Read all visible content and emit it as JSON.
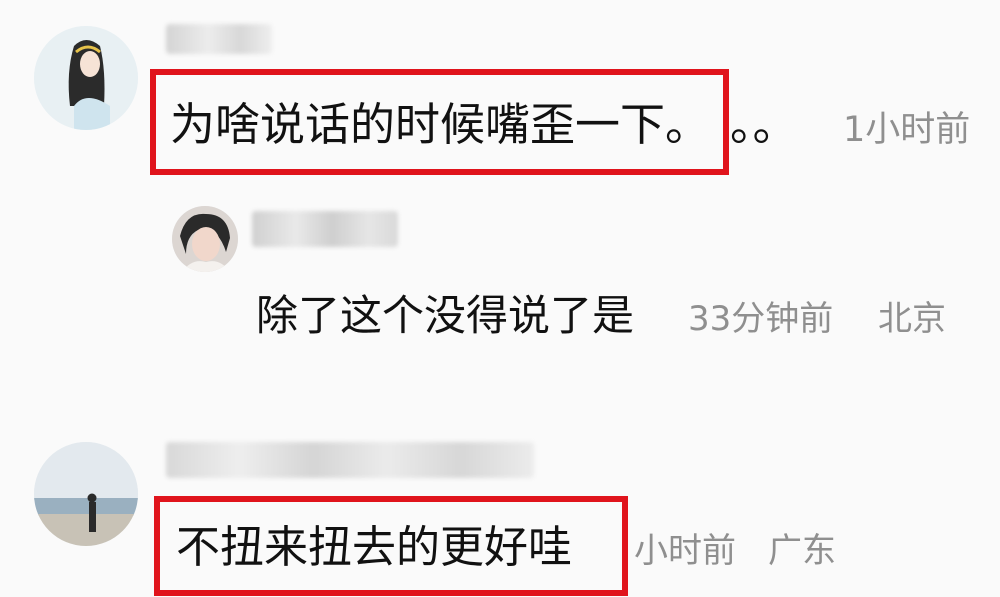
{
  "comments": [
    {
      "text": "为啥说话的时候嘴歪一下。",
      "trail": "。。",
      "time": "1小时前",
      "reply": {
        "text": "除了这个没得说了是",
        "time": "33分钟前",
        "location": "北京"
      }
    },
    {
      "text": "不扭来扭去的更好哇",
      "time": "小时前",
      "location": "广东"
    }
  ],
  "colors": {
    "highlight": "#e0141c",
    "meta": "#8f8f8f",
    "text": "#111111"
  }
}
